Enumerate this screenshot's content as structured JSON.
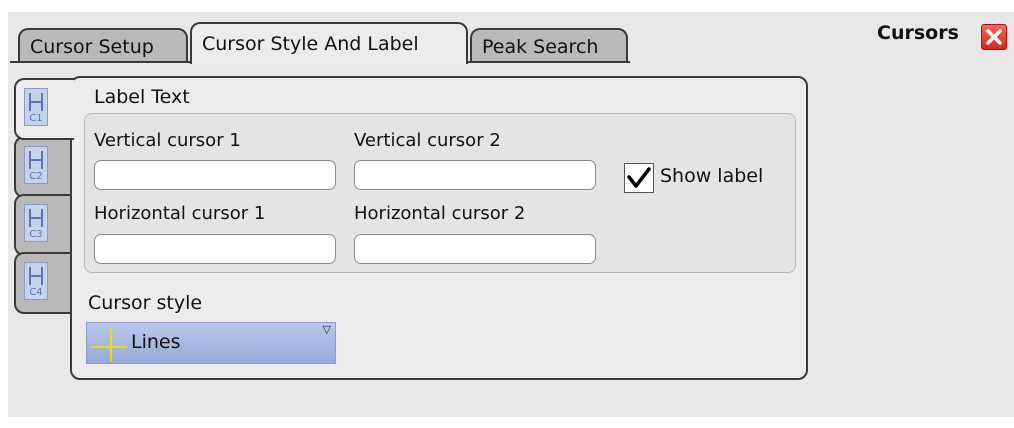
{
  "tabs": [
    {
      "label": "Cursor Setup",
      "active": false
    },
    {
      "label": "Cursor Style And Label",
      "active": true
    },
    {
      "label": "Peak Search",
      "active": false
    }
  ],
  "window": {
    "title": "Cursors"
  },
  "side_tabs": [
    {
      "label": "C1",
      "icon": "cursor-pair-icon"
    },
    {
      "label": "C2",
      "icon": "cursor-pair-icon"
    },
    {
      "label": "C3",
      "icon": "cursor-pair-icon"
    },
    {
      "label": "C4",
      "icon": "cursor-pair-icon"
    }
  ],
  "label_text": {
    "heading": "Label Text",
    "vertical_cursor_1": {
      "label": "Vertical cursor 1",
      "value": ""
    },
    "vertical_cursor_2": {
      "label": "Vertical cursor 2",
      "value": ""
    },
    "horizontal_cursor_1": {
      "label": "Horizontal cursor 1",
      "value": ""
    },
    "horizontal_cursor_2": {
      "label": "Horizontal cursor 2",
      "value": ""
    },
    "show_label": {
      "label": "Show label",
      "checked": true
    }
  },
  "cursor_style": {
    "heading": "Cursor style",
    "selected": "Lines",
    "icon": "crosshair-lines-icon",
    "accent": "#e8e000"
  },
  "colors": {
    "panel": "#e8e8e8",
    "tab_inactive": "#b9b9b9",
    "dropdown": "#a9b9e2",
    "close": "#e0392b"
  }
}
